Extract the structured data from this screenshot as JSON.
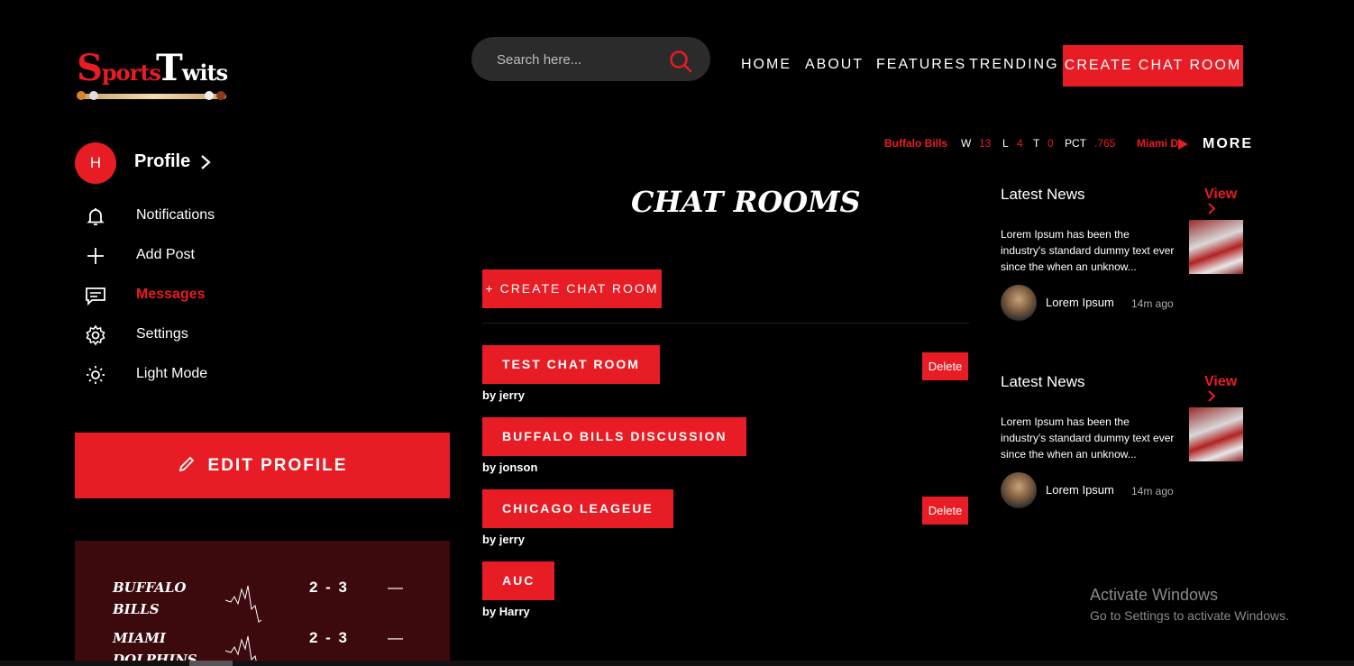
{
  "logo": {
    "part1_big": "S",
    "part1": "ports",
    "part2_big": "T",
    "part2": "wits"
  },
  "search": {
    "placeholder": "Search here..."
  },
  "nav": {
    "home": "HOME",
    "about": "ABOUT",
    "features": "FEATURES",
    "trending": "TRENDING",
    "create": "CREATE CHAT ROOM"
  },
  "profile": {
    "initial": "H",
    "label": "Profile"
  },
  "menu": [
    {
      "label": "Notifications",
      "icon": "bell-icon"
    },
    {
      "label": "Add Post",
      "icon": "plus-icon"
    },
    {
      "label": "Messages",
      "icon": "message-icon",
      "active": true
    },
    {
      "label": "Settings",
      "icon": "gear-icon"
    },
    {
      "label": "Light Mode",
      "icon": "sun-icon"
    }
  ],
  "edit_profile": "EDIT PROFILE",
  "scores": [
    {
      "team": "BUFFALO BILLS",
      "score": "2 - 3",
      "dash": "—"
    },
    {
      "team": "MIAMI DOLPHINS",
      "score": "2 - 3",
      "dash": "—"
    }
  ],
  "ticker": {
    "team1": "Buffalo Bills",
    "w_label": "W",
    "w": "13",
    "l_label": "L",
    "l": "4",
    "t_label": "T",
    "t": "0",
    "pct_label": "PCT",
    "pct": ".765",
    "team2": "Miami D",
    "more": "MORE"
  },
  "main": {
    "title": "CHAT ROOMS",
    "create": "+ CREATE CHAT ROOM",
    "delete_label": "Delete",
    "rooms": [
      {
        "name": "TEST CHAT ROOM",
        "by": "by jerry"
      },
      {
        "name": "BUFFALO BILLS DISCUSSION",
        "by": "by jonson"
      },
      {
        "name": "CHICAGO LEAGEUE",
        "by": "by jerry"
      },
      {
        "name": "AUC",
        "by": "by Harry"
      }
    ]
  },
  "news": [
    {
      "title": "Latest News",
      "view": "View",
      "body": "Lorem Ipsum has been the industry's standard dummy text ever since the when an unknow...",
      "author": "Lorem Ipsum",
      "ago": "14m ago"
    },
    {
      "title": "Latest News",
      "view": "View",
      "body": "Lorem Ipsum has been the industry's standard dummy text ever since the when an unknow...",
      "author": "Lorem Ipsum",
      "ago": "14m ago"
    }
  ],
  "os": {
    "activate": "Activate Windows",
    "activate_sub": "Go to Settings to activate Windows."
  },
  "colors": {
    "accent": "#e81c24",
    "background": "#000000",
    "scores_bg": "#3c0a0d"
  }
}
